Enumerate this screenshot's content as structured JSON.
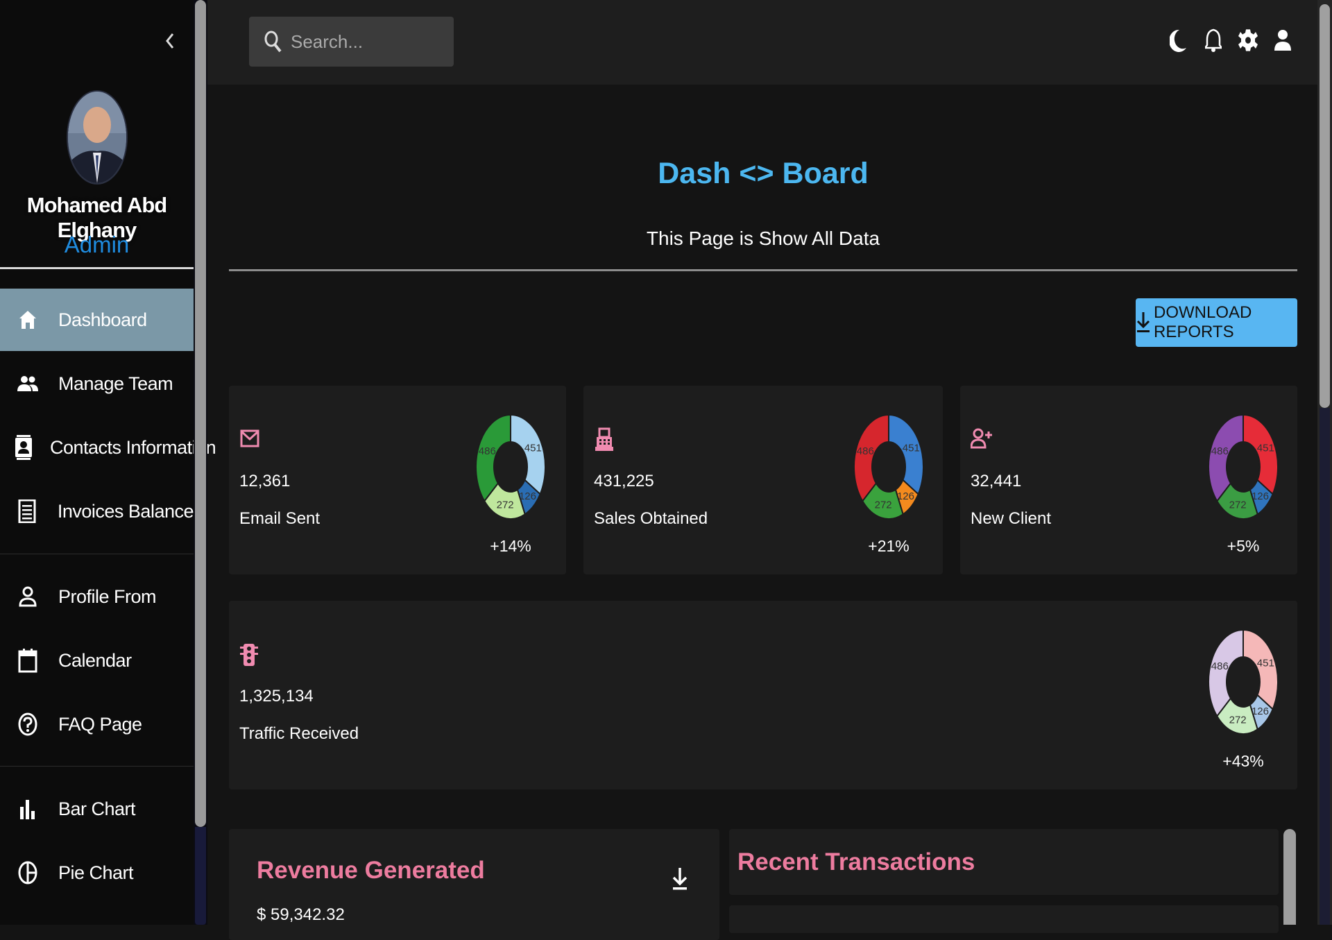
{
  "sidebar": {
    "collapse_icon": "chevron-left-icon",
    "user": {
      "name": "Mohamed Abd Elghany",
      "role": "Admin"
    },
    "items": [
      {
        "label": "Dashboard",
        "icon": "home-icon",
        "active": true
      },
      {
        "label": "Manage Team",
        "icon": "people-icon"
      },
      {
        "label": "Contacts Information",
        "icon": "contacts-icon"
      },
      {
        "label": "Invoices Balance",
        "icon": "receipt-icon"
      },
      {
        "label": "Profile From",
        "icon": "person-icon"
      },
      {
        "label": "Calendar",
        "icon": "calendar-icon"
      },
      {
        "label": "FAQ Page",
        "icon": "help-icon"
      },
      {
        "label": "Bar Chart",
        "icon": "bar-chart-icon"
      },
      {
        "label": "Pie Chart",
        "icon": "pie-chart-icon"
      }
    ]
  },
  "topbar": {
    "search_placeholder": "Search...",
    "icons": [
      "dark-mode-icon",
      "bell-icon",
      "gear-icon",
      "person-icon"
    ]
  },
  "header": {
    "title": "Dash <> Board",
    "subtitle": "This Page is Show All Data"
  },
  "download_button": {
    "label": "DOWNLOAD REPORTS",
    "icon": "download-icon",
    "color": "#58b6f2"
  },
  "stats": [
    {
      "value": "12,361",
      "label": "Email Sent",
      "change": "+14%",
      "icon": "email-icon"
    },
    {
      "value": "431,225",
      "label": "Sales Obtained",
      "change": "+21%",
      "icon": "point-of-sale-icon"
    },
    {
      "value": "32,441",
      "label": "New Client",
      "change": "+5%",
      "icon": "person-add-icon"
    },
    {
      "value": "1,325,134",
      "label": "Traffic Received",
      "change": "+43%",
      "icon": "traffic-icon"
    }
  ],
  "chart_data": [
    {
      "type": "pie",
      "labels": [
        "451",
        "126",
        "272",
        "486"
      ],
      "values": [
        451,
        126,
        272,
        486
      ],
      "colors": [
        "#a6d2ef",
        "#2a6db3",
        "#bfe79d",
        "#2a9a38"
      ]
    },
    {
      "type": "pie",
      "labels": [
        "451",
        "126",
        "272",
        "486"
      ],
      "values": [
        451,
        126,
        272,
        486
      ],
      "colors": [
        "#3a80d0",
        "#f38a1e",
        "#3aa23d",
        "#d6262d"
      ]
    },
    {
      "type": "pie",
      "labels": [
        "451",
        "126",
        "272",
        "486"
      ],
      "values": [
        451,
        126,
        272,
        486
      ],
      "colors": [
        "#e62c38",
        "#2f74bd",
        "#3b9d43",
        "#8c4cb0"
      ]
    },
    {
      "type": "pie",
      "labels": [
        "451",
        "126",
        "272",
        "486"
      ],
      "values": [
        451,
        126,
        272,
        486
      ],
      "colors": [
        "#f5b8b8",
        "#a8c7e8",
        "#c9ecc1",
        "#d8c8e6"
      ]
    }
  ],
  "revenue": {
    "title": "Revenue Generated",
    "value": "$ 59,342.32",
    "download_icon": "download-icon"
  },
  "transactions": {
    "title": "Recent Transactions"
  },
  "colors": {
    "accent": "#4cb7f0",
    "section_title": "#ed7c9f",
    "stat_icon": "#f08bb0",
    "sidebar_active": "#7b98a7",
    "role": "#1f8bde"
  }
}
